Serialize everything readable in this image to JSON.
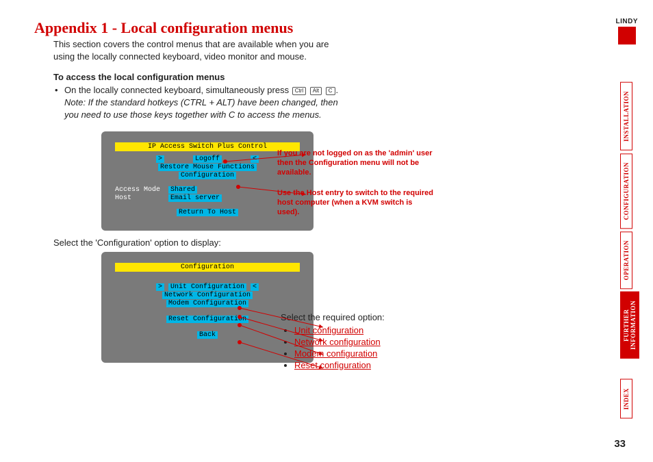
{
  "title": "Appendix 1 - Local configuration menus",
  "intro": "This section covers the control menus that are available when you are using the locally connected keyboard, video monitor and mouse.",
  "access_heading": "To access the local configuration menus",
  "access_bullet_pre": "On the locally connected keyboard, simultaneously press ",
  "keys": {
    "ctrl": "Ctrl",
    "alt": "Alt",
    "c": "C"
  },
  "access_note": "Note: If the standard hotkeys (CTRL + ALT) have been changed, then you need to use those keys together with C to access the menus.",
  "term1": {
    "title": "IP Access Switch Plus Control",
    "logoff": "Logoff",
    "restore": "Restore Mouse Functions",
    "config": "Configuration",
    "access_mode_label": "Access Mode",
    "access_mode_value": "Shared",
    "host_label": "Host",
    "host_value": "Email server",
    "return": "Return To Host"
  },
  "callout1": "If you are not logged on as the 'admin' user then the Configuration menu will not be available.",
  "callout2": "Use the Host entry to switch to the required host computer (when a KVM switch is used).",
  "midtext": "Select the 'Configuration' option to display:",
  "term2": {
    "title": "Configuration",
    "unit": "Unit Configuration",
    "network": "Network Configuration",
    "modem": "Modem Configuration",
    "reset": "Reset Configuration",
    "back": "Back"
  },
  "options_label": "Select the required option:",
  "options": {
    "unit": "Unit configuration",
    "network": "Network configuration",
    "modem": "Modem configuration",
    "reset": "Reset configuration"
  },
  "page_number": "33",
  "brand": "LINDY",
  "tabs": {
    "install": "INSTALLATION",
    "config": "CONFIGURATION",
    "operation": "OPERATION",
    "further1": "FURTHER",
    "further2": "INFORMATION",
    "index": "INDEX"
  }
}
